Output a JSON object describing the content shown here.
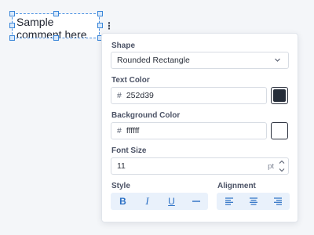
{
  "canvas": {
    "comment_text": "Sample comment here"
  },
  "panel": {
    "shape": {
      "label": "Shape",
      "value": "Rounded Rectangle"
    },
    "text_color": {
      "label": "Text Color",
      "hash": "#",
      "value": "252d39",
      "swatch": "#252d39"
    },
    "background_color": {
      "label": "Background Color",
      "hash": "#",
      "value": "ffffff",
      "swatch": "#ffffff"
    },
    "font_size": {
      "label": "Font Size",
      "value": "11",
      "unit": "pt"
    },
    "style": {
      "label": "Style",
      "buttons": [
        {
          "icon": "bold-icon",
          "text": "B"
        },
        {
          "icon": "italic-icon",
          "text": "I"
        },
        {
          "icon": "underline-icon",
          "text": "U"
        },
        {
          "icon": "strikethrough-icon",
          "text": ""
        }
      ]
    },
    "alignment": {
      "label": "Alignment",
      "buttons": [
        {
          "icon": "align-left-icon"
        },
        {
          "icon": "align-center-icon"
        },
        {
          "icon": "align-right-icon"
        }
      ]
    }
  },
  "colors": {
    "accent": "#2a6fc4",
    "selection": "#4a90e2",
    "button_bg": "#e9f1fb"
  }
}
